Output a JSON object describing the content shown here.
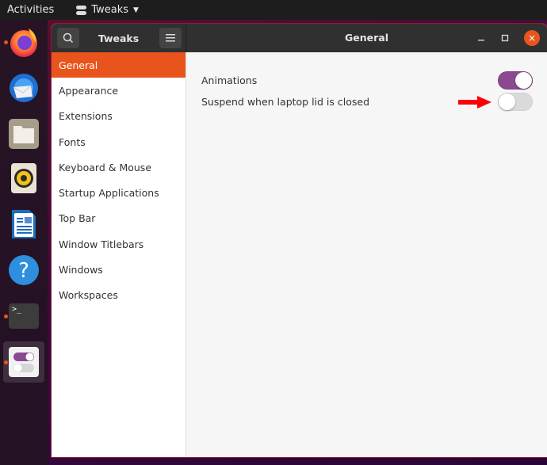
{
  "topbar": {
    "activities": "Activities",
    "app_name": "Tweaks"
  },
  "dock": {
    "apps": [
      {
        "name": "Firefox",
        "icon": "firefox-icon",
        "running": true
      },
      {
        "name": "Thunderbird",
        "icon": "thunderbird-icon",
        "running": false
      },
      {
        "name": "Files",
        "icon": "files-icon",
        "running": false
      },
      {
        "name": "Rhythmbox",
        "icon": "rhythmbox-icon",
        "running": false
      },
      {
        "name": "LibreOffice Writer",
        "icon": "writer-icon",
        "running": false
      },
      {
        "name": "Help",
        "icon": "help-icon",
        "running": false
      },
      {
        "name": "Terminal",
        "icon": "terminal-icon",
        "running": true
      },
      {
        "name": "Tweaks",
        "icon": "tweaks-icon",
        "running": true,
        "active": true
      }
    ],
    "terminal_prompt": ">_",
    "help_glyph": "?"
  },
  "window": {
    "sidebar_title": "Tweaks",
    "page_title": "General",
    "close_glyph": "×",
    "sidebar": {
      "items": [
        {
          "label": "General",
          "selected": true
        },
        {
          "label": "Appearance",
          "selected": false
        },
        {
          "label": "Extensions",
          "selected": false
        },
        {
          "label": "Fonts",
          "selected": false
        },
        {
          "label": "Keyboard & Mouse",
          "selected": false
        },
        {
          "label": "Startup Applications",
          "selected": false
        },
        {
          "label": "Top Bar",
          "selected": false
        },
        {
          "label": "Window Titlebars",
          "selected": false
        },
        {
          "label": "Windows",
          "selected": false
        },
        {
          "label": "Workspaces",
          "selected": false
        }
      ]
    },
    "settings": [
      {
        "label": "Animations",
        "enabled": true
      },
      {
        "label": "Suspend when laptop lid is closed",
        "enabled": false
      }
    ]
  },
  "colors": {
    "accent": "#e9541d",
    "switch_on": "#8b4a8f",
    "switch_off": "#dadada",
    "annotation_arrow": "#ff0000"
  }
}
